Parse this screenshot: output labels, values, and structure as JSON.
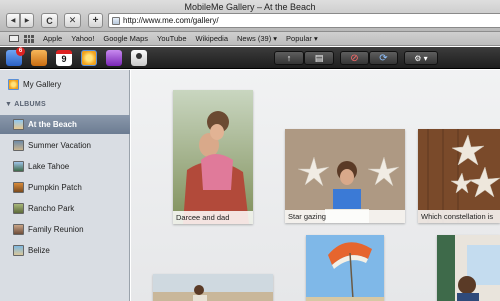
{
  "window": {
    "title": "MobileMe Gallery – At the Beach"
  },
  "toolbar": {
    "back_glyph": "◀",
    "forward_glyph": "▶",
    "reload_glyph": "C",
    "stop_glyph": "✕",
    "add_glyph": "+",
    "url": "http://www.me.com/gallery/"
  },
  "bookmarks": [
    "Apple",
    "Yahoo!",
    "Google Maps",
    "YouTube",
    "Wikipedia",
    "News (39) ▾",
    "Popular ▾"
  ],
  "appbar": {
    "mail_badge": "6",
    "calendar_label": "9",
    "colors": {
      "mail": "#3d7be0",
      "contacts": "#e08a2a",
      "calendar": "#ffffff",
      "gallery": "#f2c21c",
      "idisk": "#9b3cd6",
      "account": "#e8e8e8"
    },
    "upload_glyph": "↑",
    "slideshow_glyph": "▤",
    "delete_glyph": "⊘",
    "share_glyph": "⟳",
    "settings_glyph": "⚙ ▾"
  },
  "sidebar": {
    "my_gallery": "My Gallery",
    "albums_header": "ALBUMS",
    "albums": [
      {
        "label": "At the Beach",
        "selected": true
      },
      {
        "label": "Summer Vacation",
        "selected": false
      },
      {
        "label": "Lake Tahoe",
        "selected": false
      },
      {
        "label": "Pumpkin Patch",
        "selected": false
      },
      {
        "label": "Rancho Park",
        "selected": false
      },
      {
        "label": "Family Reunion",
        "selected": false
      },
      {
        "label": "Belize",
        "selected": false
      }
    ]
  },
  "gallery": {
    "photos": [
      {
        "caption": "Darcee and dad"
      },
      {
        "caption": "Star gazing"
      },
      {
        "caption": "Which constellation is"
      }
    ]
  }
}
